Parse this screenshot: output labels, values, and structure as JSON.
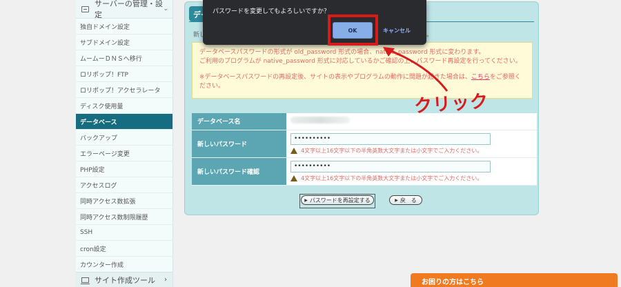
{
  "sidebar": {
    "header_label": "サーバーの管理・設定",
    "items": [
      {
        "label": "独自ドメイン設定"
      },
      {
        "label": "サブドメイン設定"
      },
      {
        "label": "ムームーＤＮＳへ移行"
      },
      {
        "label": "ロリポップ！FTP"
      },
      {
        "label": "ロリポップ！アクセラレータ"
      },
      {
        "label": "ディスク使用量"
      },
      {
        "label": "データベース"
      },
      {
        "label": "バックアップ"
      },
      {
        "label": "エラーページ変更"
      },
      {
        "label": "PHP設定"
      },
      {
        "label": "アクセスログ"
      },
      {
        "label": "同時アクセス数拡張"
      },
      {
        "label": "同時アクセス数制限履歴"
      },
      {
        "label": "SSH"
      },
      {
        "label": "cron設定"
      },
      {
        "label": "カウンター作成"
      }
    ],
    "footer_label": "サイト作成ツール"
  },
  "panel": {
    "title": "デー",
    "intro_head": "新し",
    "intro_tail": "。",
    "notice": {
      "line1": "データベースパスワードの形式が old_password 形式の場合、native_password 形式に変わります。",
      "line2": "ご利用のプログラムが native_password 形式に対応しているかご確認の上、パスワード再設定を行ってください。",
      "line3_before": "※データベースパスワードの再設定後、サイトの表示やプログラムの動作に問題が起きた場合は、",
      "link": "こちら",
      "line3_after": "をご参照ください。"
    },
    "form": {
      "db_name_label": "データベース名",
      "new_pw_label": "新しいパスワード",
      "new_pw_value": "••••••••••",
      "confirm_pw_label": "新しいパスワード確認",
      "confirm_pw_value": "••••••••••",
      "hint": "4文字以上16文字以下の半角英数大文字または小文字でご入力ください。"
    },
    "submit_label": "パスワードを再設定する",
    "back_label": "戻　る"
  },
  "dialog": {
    "message": "パスワードを変更してもよろしいですか？",
    "ok_label": "OK",
    "cancel_label": "キャンセル"
  },
  "annotation": {
    "text": "クリック",
    "color": "#d61c1c"
  },
  "help_banner": "お困りの方はこちら",
  "colors": {
    "active_nav": "#176d80",
    "panel_bg": "#bfe5e6",
    "table_header": "#5ba6b2",
    "help_banner": "#f07a20"
  }
}
